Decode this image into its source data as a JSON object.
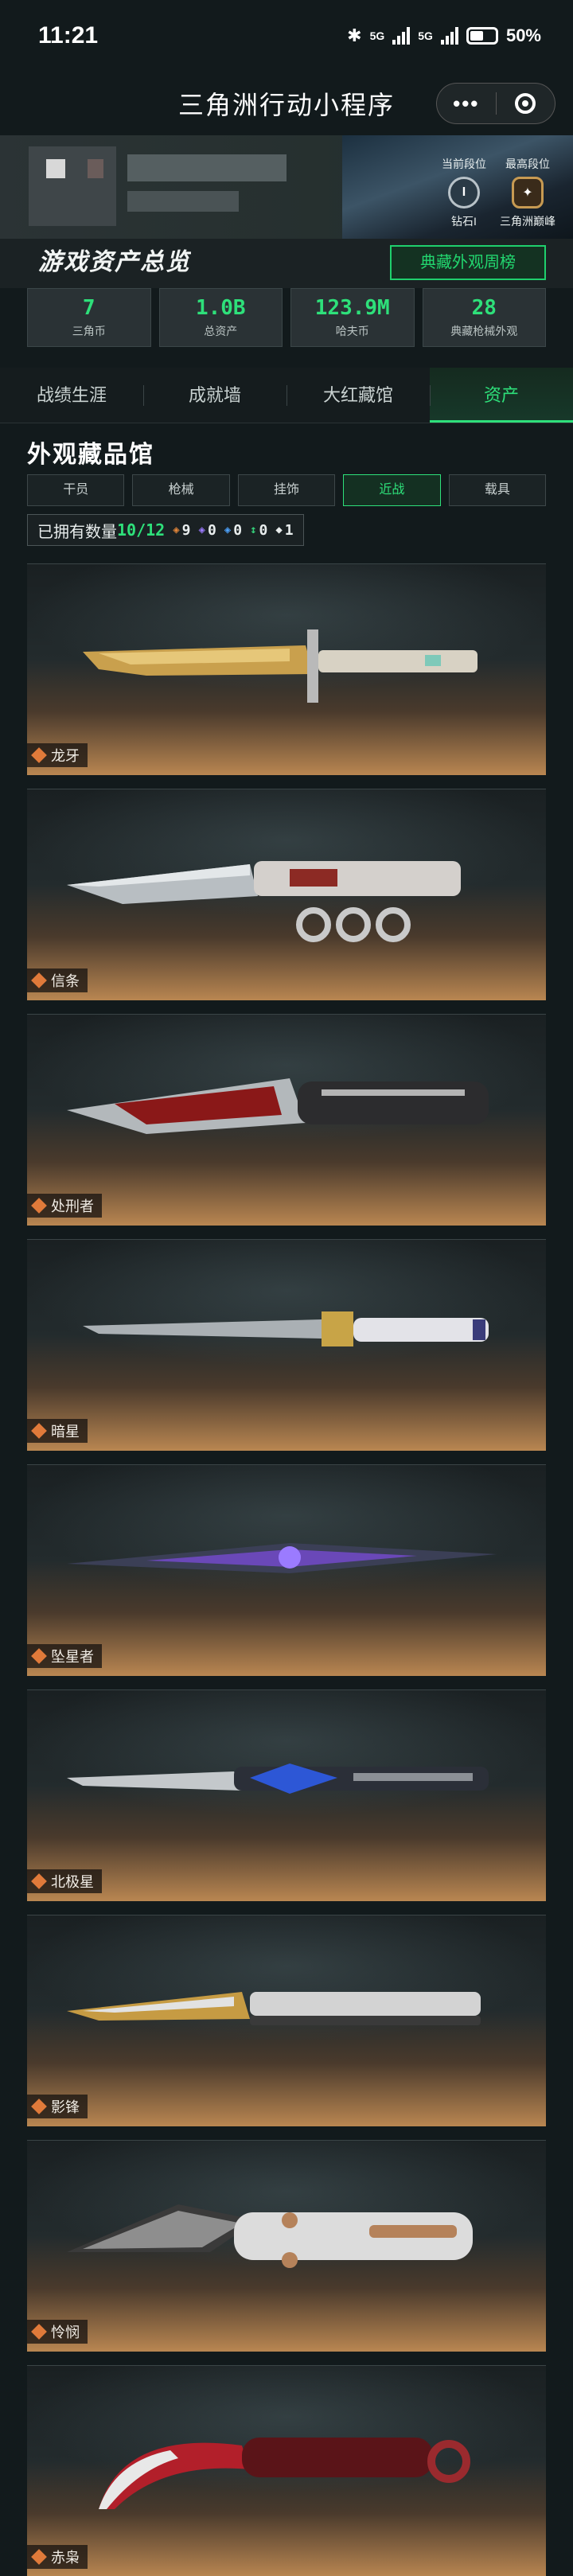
{
  "status_bar": {
    "time": "11:21",
    "net1": "5G",
    "net2": "5G",
    "battery": "50%"
  },
  "nav": {
    "title": "三角洲行动小程序",
    "more_label": "•••"
  },
  "profile": {
    "current_rank_label": "当前段位",
    "current_rank_value": "钻石I",
    "current_rank_badge": "I",
    "highest_rank_label": "最高段位",
    "highest_rank_value": "三角洲巅峰"
  },
  "overview": {
    "title": "游戏资产总览",
    "weekly_button": "典藏外观周榜",
    "stats": [
      {
        "value": "7",
        "caption": "三角币"
      },
      {
        "value": "1.0B",
        "caption": "总资产"
      },
      {
        "value": "123.9M",
        "caption": "哈夫币"
      },
      {
        "value": "28",
        "caption": "典藏枪械外观"
      }
    ]
  },
  "tabs": [
    {
      "label": "战绩生涯",
      "active": false
    },
    {
      "label": "成就墙",
      "active": false
    },
    {
      "label": "大红藏馆",
      "active": false
    },
    {
      "label": "资产",
      "active": true
    }
  ],
  "collection": {
    "title": "外观藏品馆",
    "filters": [
      {
        "label": "干员",
        "active": false
      },
      {
        "label": "枪械",
        "active": false
      },
      {
        "label": "挂饰",
        "active": false
      },
      {
        "label": "近战",
        "active": true
      },
      {
        "label": "载具",
        "active": false
      }
    ],
    "owned_label": "已拥有数量",
    "owned_count": "10/12",
    "rarity_counts": [
      {
        "icon": "orange-rarity-icon",
        "color": "#e4873a",
        "value": "9"
      },
      {
        "icon": "purple-rarity-icon",
        "color": "#9b7bff",
        "value": "0"
      },
      {
        "icon": "blue-rarity-icon",
        "color": "#4ea4ff",
        "value": "0"
      },
      {
        "icon": "green-rarity-icon",
        "color": "#35d07a",
        "value": "0"
      },
      {
        "icon": "white-rarity-icon",
        "color": "#e8ecec",
        "value": "1"
      }
    ],
    "items": [
      {
        "name": "龙牙"
      },
      {
        "name": "信条"
      },
      {
        "name": "处刑者"
      },
      {
        "name": "暗星"
      },
      {
        "name": "坠星者"
      },
      {
        "name": "北极星"
      },
      {
        "name": "影锋"
      },
      {
        "name": "怜悯"
      },
      {
        "name": "赤枭"
      }
    ]
  }
}
